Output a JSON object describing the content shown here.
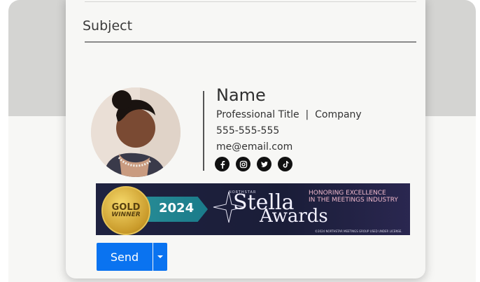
{
  "composer": {
    "subject_label": "Subject"
  },
  "signature": {
    "name": "Name",
    "title_company": "Professional Title  |  Company",
    "phone": "555-555-555",
    "email": "me@email.com",
    "social_icons": [
      "facebook-icon",
      "instagram-icon",
      "twitter-icon",
      "tiktok-icon"
    ]
  },
  "banner": {
    "medal_top": "GOLD",
    "medal_bottom": "WINNER",
    "year": "2024",
    "brand_small": "NORTHSTAR",
    "award_word1": "Stella",
    "award_word2": "Awards",
    "tagline_line1": "HONORING EXCELLENCE",
    "tagline_line2": "IN THE MEETINGS INDUSTRY",
    "fineprint": "©2024 NORTHSTAR MEETINGS GROUP USED UNDER LICENSE."
  },
  "actions": {
    "send_label": "Send"
  },
  "colors": {
    "primary_button": "#0a73f0",
    "banner_bg": "#1f2240"
  }
}
